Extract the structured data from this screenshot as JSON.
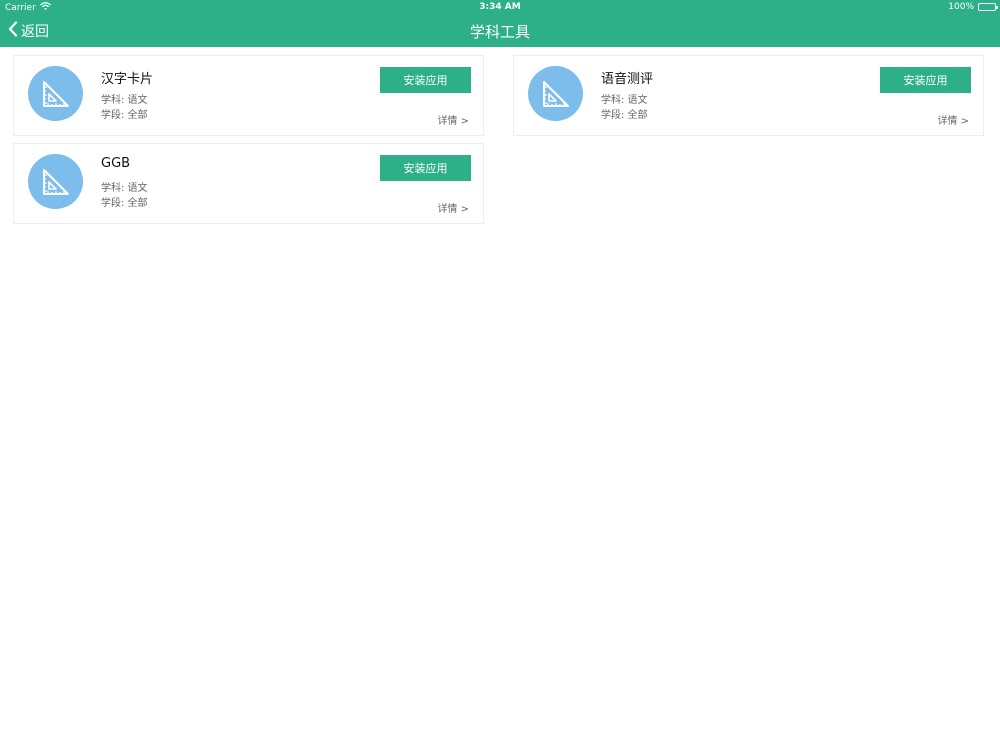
{
  "colors": {
    "accent": "#2db087",
    "icon_bg": "#7dbdeb"
  },
  "status_bar": {
    "carrier": "Carrier",
    "time": "3:34 AM",
    "battery": "100%",
    "battery_level": 1.0
  },
  "nav": {
    "back_label": "返回",
    "title": "学科工具"
  },
  "apps": [
    {
      "name": "汉字卡片",
      "subject": "学科: 语文",
      "stage": "学段: 全部",
      "install_label": "安装应用",
      "detail_label": "详情 >",
      "icon": "set-square-icon"
    },
    {
      "name": "语音测评",
      "subject": "学科: 语文",
      "stage": "学段: 全部",
      "install_label": "安装应用",
      "detail_label": "详情 >",
      "icon": "set-square-icon"
    },
    {
      "name": "GGB",
      "subject": "学科: 语文",
      "stage": "学段: 全部",
      "install_label": "安装应用",
      "detail_label": "详情 >",
      "icon": "set-square-icon"
    }
  ]
}
